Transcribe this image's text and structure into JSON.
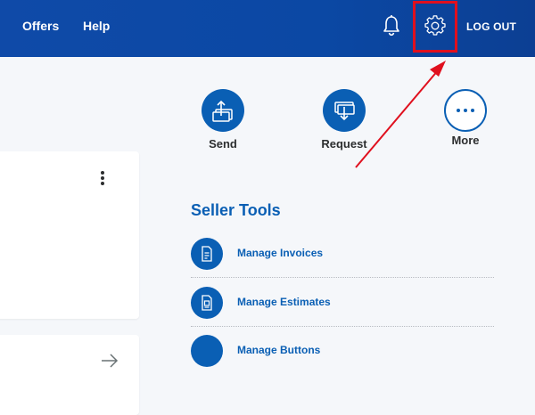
{
  "header": {
    "nav": [
      {
        "label": "Offers"
      },
      {
        "label": "Help"
      }
    ],
    "logout_label": "LOG OUT",
    "icons": {
      "notifications": "bell-icon",
      "settings": "gear-icon"
    }
  },
  "actions": [
    {
      "label": "Send",
      "icon": "send-money-icon"
    },
    {
      "label": "Request",
      "icon": "request-money-icon"
    },
    {
      "label": "More",
      "icon": "more-dots-icon"
    }
  ],
  "seller_tools": {
    "title": "Seller Tools",
    "items": [
      {
        "label": "Manage Invoices",
        "icon": "invoice-icon"
      },
      {
        "label": "Manage Estimates",
        "icon": "estimate-icon"
      },
      {
        "label": "Manage Buttons",
        "icon": "button-icon"
      }
    ]
  },
  "colors": {
    "header_bg": "#0f4aa8",
    "brand_blue": "#0a5fb4",
    "annotation_red": "#e0101e",
    "page_bg": "#f5f7fa"
  }
}
